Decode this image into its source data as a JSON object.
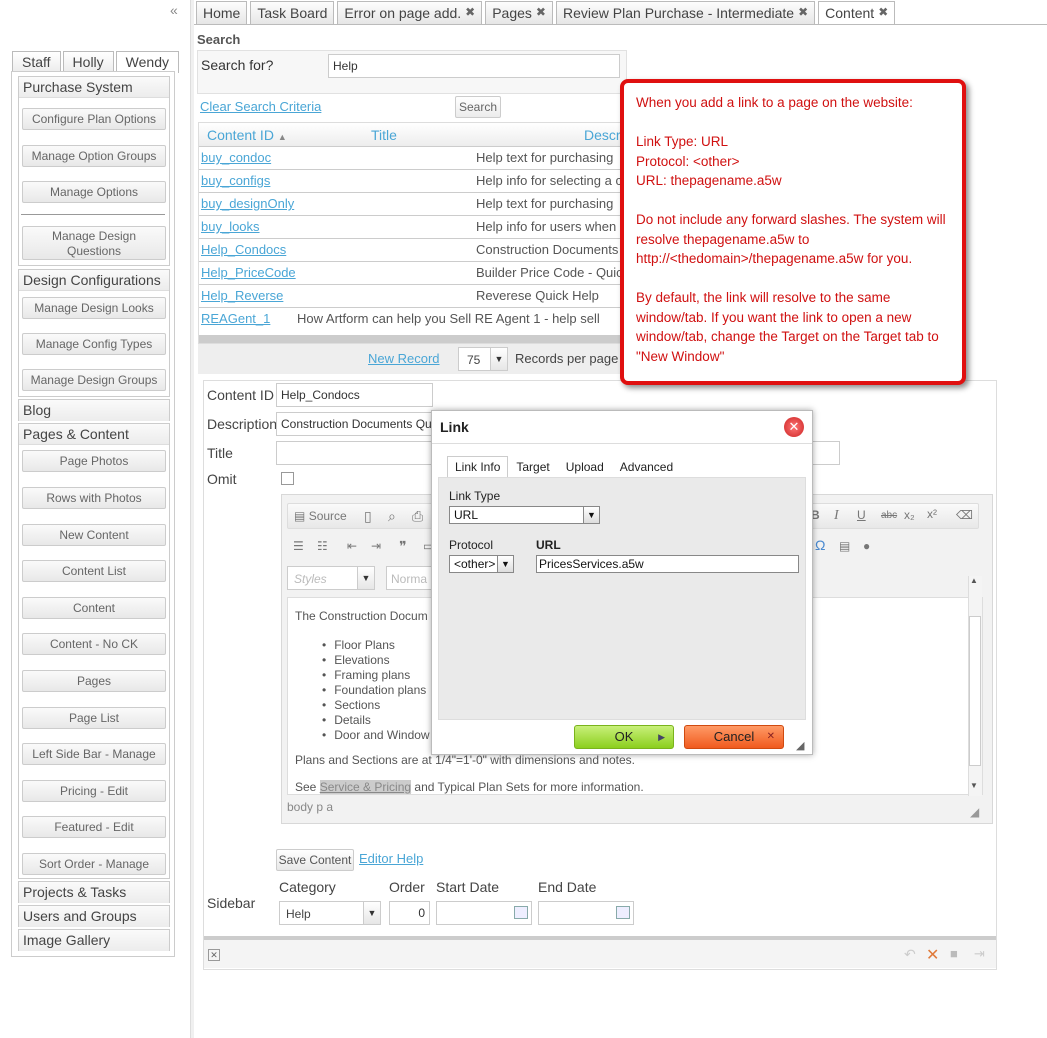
{
  "collapse_icon": "«",
  "tabs": [
    {
      "label": "Home",
      "closable": false
    },
    {
      "label": "Task Board",
      "closable": false
    },
    {
      "label": "Error on page add.",
      "closable": true
    },
    {
      "label": "Pages",
      "closable": true
    },
    {
      "label": "Review Plan Purchase - Intermediate",
      "closable": true
    },
    {
      "label": "Content",
      "closable": true,
      "active": true
    }
  ],
  "tab_close_glyph": "✖",
  "user_tabs": [
    "Staff",
    "Holly",
    "Wendy"
  ],
  "sidebar": {
    "purchase_system": "Purchase System",
    "configure_plan_options": "Configure Plan Options",
    "manage_option_groups": "Manage Option Groups",
    "manage_options": "Manage Options",
    "manage_design_questions_1": "Manage Design",
    "manage_design_questions_2": "Questions",
    "design_configurations": "Design Configurations",
    "manage_design_looks": "Manage Design Looks",
    "manage_config_types": "Manage Config Types",
    "manage_design_groups": "Manage Design Groups",
    "blog": "Blog",
    "pages_content": "Pages & Content",
    "page_photos": "Page Photos",
    "rows_with_photos": "Rows with Photos",
    "new_content": "New Content",
    "content_list": "Content List",
    "content": "Content",
    "content_no_ck": "Content - No CK",
    "pages": "Pages",
    "page_list": "Page List",
    "left_side_bar": "Left Side Bar - Manage",
    "pricing_edit": "Pricing - Edit",
    "featured_edit": "Featured - Edit",
    "sort_order": "Sort Order - Manage",
    "projects_tasks": "Projects & Tasks",
    "users_groups": "Users and Groups",
    "image_gallery": "Image Gallery"
  },
  "search": {
    "title": "Search",
    "label": "Search for?",
    "value": "Help",
    "clear": "Clear Search Criteria",
    "button": "Search"
  },
  "grid": {
    "col_id": "Content ID",
    "sort_icon": "▲",
    "col_title": "Title",
    "col_desc": "Descr",
    "rows": [
      {
        "id": "buy_condoc",
        "desc": "Help text for purchasing"
      },
      {
        "id": "buy_configs",
        "desc": "Help info for selecting a c"
      },
      {
        "id": "buy_designOnly",
        "desc": "Help text for purchasing"
      },
      {
        "id": "buy_looks",
        "desc": "Help info for users when"
      },
      {
        "id": "Help_Condocs",
        "desc": "Construction Documents"
      },
      {
        "id": "Help_PriceCode",
        "desc": "Builder Price Code - Quic"
      },
      {
        "id": "Help_Reverse",
        "desc": "Reverese Quick Help"
      }
    ],
    "last_row_id": "REAGent_1",
    "last_row_title": "How Artform can help you Sell RE Agent 1 - help sell",
    "new_record": "New Record",
    "page_size": "75",
    "per_page": "Records per page"
  },
  "form": {
    "content_id_label": "Content ID",
    "content_id_value": "Help_Condocs",
    "description_label": "Description",
    "description_value": "Construction Documents Qu",
    "title_label": "Title",
    "omit_label": "Omit",
    "styles_placeholder": "Styles",
    "format_placeholder": "Norma",
    "source_label": "Source",
    "editor_intro": "The Construction Docum",
    "editor_bullets": [
      "Floor Plans",
      "Elevations",
      "Framing plans",
      "Foundation plans",
      "Sections",
      "Details",
      "Door and Window"
    ],
    "editor_plans": "Plans and Sections are at 1/4\"=1'-0\" with dimensions and notes.",
    "editor_see": "See",
    "editor_link": "Service & Pricing",
    "editor_rest": "and Typical Plan Sets for more information.",
    "path": "body   p   a",
    "save_button": "Save Content",
    "editor_help": "Editor Help",
    "sidebar_label": "Sidebar",
    "category_label": "Category",
    "category_value": "Help",
    "order_label": "Order",
    "order_value": "0",
    "start_label": "Start Date",
    "end_label": "End Date"
  },
  "dialog": {
    "title": "Link",
    "close": "✕",
    "tabs": [
      "Link Info",
      "Target",
      "Upload",
      "Advanced"
    ],
    "link_type_label": "Link Type",
    "link_type_value": "URL",
    "protocol_label": "Protocol",
    "protocol_value": "<other>",
    "url_label": "URL",
    "url_value": "PricesServices.a5w",
    "ok": "OK",
    "cancel": "Cancel"
  },
  "callout": {
    "line1": "When you add a link to a page on the website:",
    "line2": "Link Type: URL",
    "line3": "Protocol: <other>",
    "line4": "URL: thepagename.a5w",
    "line5": "Do not include any forward slashes. The system will resolve thepagename.a5w to http://<thedomain>/thepagename.a5w for you.",
    "line6": "By default, the link will resolve to the same window/tab. If you want the link to open a new window/tab, change the Target on the Target tab to \"New Window\""
  },
  "colors": {
    "link": "#4aa6d6",
    "callout_red": "#e01010",
    "ok_green": "#8ccf1e",
    "cancel_orange": "#f05a1e"
  }
}
